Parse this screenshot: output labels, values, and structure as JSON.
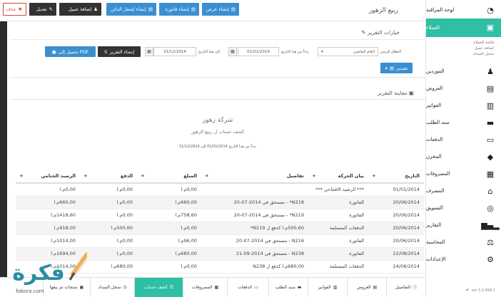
{
  "sidebar": {
    "items": [
      {
        "label": "لوحة المراقبة",
        "icon": "dashboard-icon"
      },
      {
        "label": "العملاء",
        "icon": "users-icon"
      },
      {
        "label": "الموردين",
        "icon": "user-icon"
      },
      {
        "label": "العروض",
        "icon": "calculator-icon"
      },
      {
        "label": "الفواتير",
        "icon": "invoice-icon"
      },
      {
        "label": "سند الطلب",
        "icon": "briefcase-icon"
      },
      {
        "label": "الدفعات",
        "icon": "credit-card-icon"
      },
      {
        "label": "المخزن",
        "icon": "box-icon"
      },
      {
        "label": "المصروفات",
        "icon": "expenses-icon"
      },
      {
        "label": "المصرف",
        "icon": "bank-icon"
      },
      {
        "label": "التسويق",
        "icon": "target-icon"
      },
      {
        "label": "التقارير",
        "icon": "bar-chart-icon"
      },
      {
        "label": "المحاسبة",
        "icon": "scale-icon"
      },
      {
        "label": "الإعدادات",
        "icon": "gear-icon"
      }
    ],
    "subs": [
      "قائمة العملاء",
      "إضافة عميل",
      "سجل السداد"
    ],
    "version": "ver 1.0.999.1"
  },
  "topbar": {
    "breadcrumb": "ربيع الزهور",
    "delete": "حذف",
    "edit": "تعديل",
    "add_client": "إضافة عميل",
    "create_notice": "إنشاء إشعار الدائن",
    "create_invoice": "إنشاء فاتورة",
    "create_quote": "إنشاء عرض"
  },
  "report_options": {
    "title": "خيارات التقرير",
    "range_label": "النطاق الزمني",
    "range_value": "العام الماضي",
    "from_label": "بدءاً من هذا التاريخ",
    "from_value": "01/01/2014",
    "to_label": "إلى هذا التاريخ",
    "to_value": "31/12/2014",
    "create_report": "إنشاء التقرير",
    "download_pdf": "تحميل إلى PDF",
    "export": "تصدير"
  },
  "preview": {
    "title": "معاينة التقرير",
    "company": "شركة زهور",
    "subtitle": "كشف حساب ل ربيع الزهور",
    "period": "بدءاً من هذا التاريخ 01/01/2014 إلى 31/12/2014"
  },
  "table": {
    "headers": [
      "التاريخ",
      "بيان الحركة",
      "تفاصيل",
      "المبلغ",
      "الدفع",
      "الرصيد الختامي"
    ],
    "rows": [
      [
        "01/01/2014",
        "*** الرصيد الافتتاحي ***",
        "",
        "0,00م.ا",
        "0,00م.ا",
        "0,00م.ا"
      ],
      [
        "20/06/2014",
        "الفاتورة",
        "N218* - مستحق في 2014-07-20",
        "660,00م.ا",
        "0,00م.ا",
        "660,00م.ا"
      ],
      [
        "20/06/2014",
        "الفاتورة",
        "N219* - مستحق في 2014-07-20",
        "758,60م.ا",
        "0,00م.ا",
        "1418,60م.ا"
      ],
      [
        "20/06/2014",
        "الدفعات المستلمة",
        "500,60م.ا كدفع ل N219*",
        "0,00م.ا",
        "500,60م.ا",
        "918,00م.ا"
      ],
      [
        "20/06/2014",
        "الفاتورة",
        "N216 - مستحق في 2014-07-20",
        "96,00م.ا",
        "0,00م.ا",
        "1014,00م.ا"
      ],
      [
        "22/08/2014",
        "الفاتورة",
        "N238 - مستحق في 2014-09-21",
        "680,00م.ا",
        "0,00م.ا",
        "1694,00م.ا"
      ],
      [
        "24/08/2014",
        "الدفعات المستلمة",
        "680,00م.ا كدفع ل N238",
        "0,00م.ا",
        "680,00م.ا",
        "1014,00م.ا"
      ]
    ]
  },
  "bottom_tabs": [
    {
      "label": "التفاصيل",
      "icon": "info-icon"
    },
    {
      "label": "العروض",
      "icon": "calculator-icon"
    },
    {
      "label": "الفواتير",
      "icon": "invoice-icon"
    },
    {
      "label": "سند الطلب",
      "icon": "briefcase-icon"
    },
    {
      "label": "الدفعات",
      "icon": "credit-card-icon"
    },
    {
      "label": "المصروفات",
      "icon": "expenses-icon"
    },
    {
      "label": "كشف حساب",
      "icon": "list-icon"
    },
    {
      "label": "سجل السداد",
      "icon": "clock-icon"
    },
    {
      "label": "منتجات تم بيعها",
      "icon": "product-icon"
    }
  ],
  "watermark": {
    "brand": "فكرة",
    "domain": "fokora.com"
  },
  "colors": {
    "accent": "#2fbfa3",
    "blue": "#3a8fd1",
    "dark": "#333333",
    "danger": "#d9443a"
  }
}
